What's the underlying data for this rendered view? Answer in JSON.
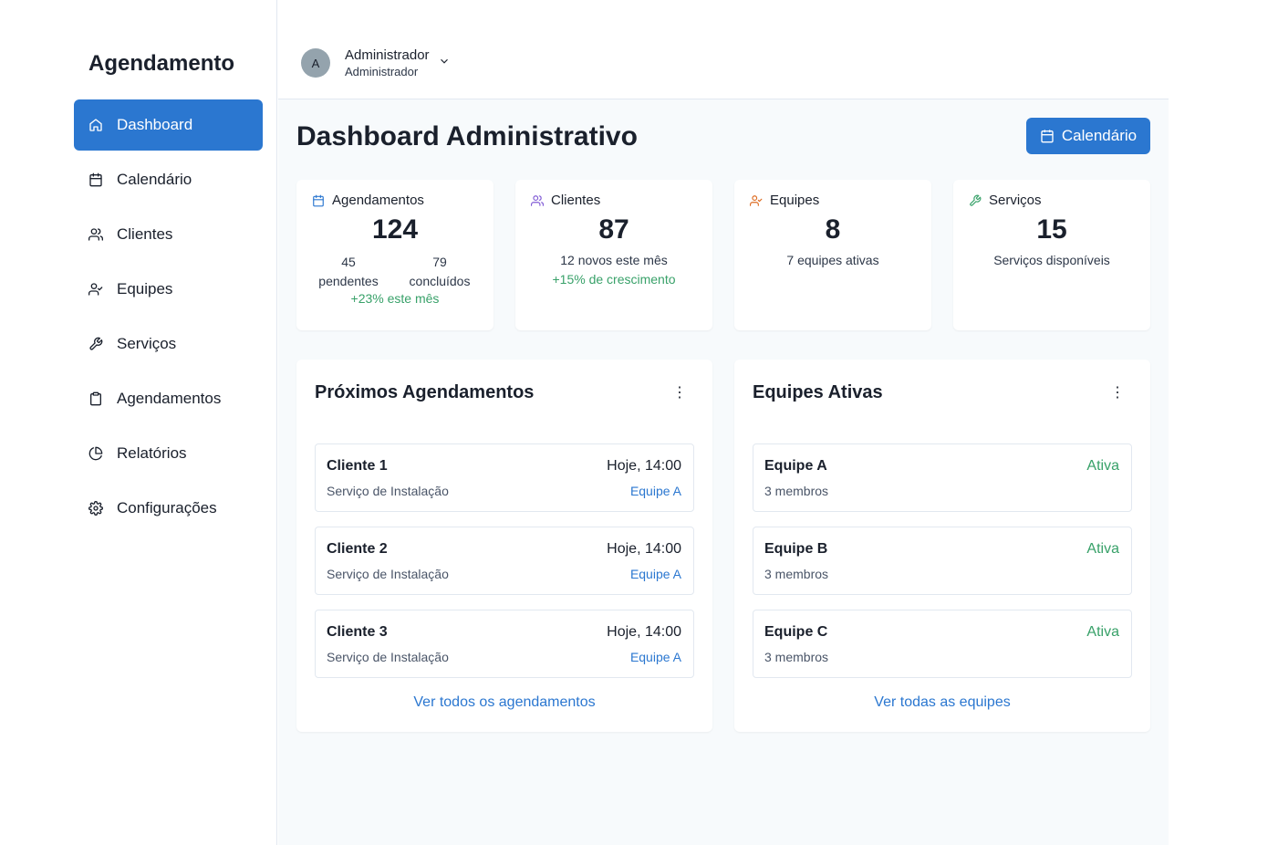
{
  "sidebar": {
    "brand": "Agendamento",
    "items": [
      {
        "label": "Dashboard",
        "icon": "home-icon",
        "active": true
      },
      {
        "label": "Calendário",
        "icon": "calendar-icon",
        "active": false
      },
      {
        "label": "Clientes",
        "icon": "users-icon",
        "active": false
      },
      {
        "label": "Equipes",
        "icon": "user-check-icon",
        "active": false
      },
      {
        "label": "Serviços",
        "icon": "wrench-icon",
        "active": false
      },
      {
        "label": "Agendamentos",
        "icon": "clipboard-icon",
        "active": false
      },
      {
        "label": "Relatórios",
        "icon": "pie-chart-icon",
        "active": false
      },
      {
        "label": "Configurações",
        "icon": "gear-icon",
        "active": false
      }
    ]
  },
  "topbar": {
    "avatar_initial": "A",
    "user_name": "Administrador",
    "user_role": "Administrador"
  },
  "main": {
    "title": "Dashboard Administrativo",
    "calendar_button": "Calendário"
  },
  "stats": {
    "agendamentos": {
      "label": "Agendamentos",
      "value": "124",
      "pending_count": "45",
      "pending_label": "pendentes",
      "done_count": "79",
      "done_label": "concluídos",
      "growth": "+23% este mês"
    },
    "clientes": {
      "label": "Clientes",
      "value": "87",
      "sub": "12 novos este mês",
      "growth": "+15% de crescimento"
    },
    "equipes": {
      "label": "Equipes",
      "value": "8",
      "sub": "7 equipes ativas"
    },
    "servicos": {
      "label": "Serviços",
      "value": "15",
      "sub": "Serviços disponíveis"
    }
  },
  "upcoming": {
    "title": "Próximos Agendamentos",
    "items": [
      {
        "client": "Cliente 1",
        "service": "Serviço de Instalação",
        "time": "Hoje, 14:00",
        "team": "Equipe A"
      },
      {
        "client": "Cliente 2",
        "service": "Serviço de Instalação",
        "time": "Hoje, 14:00",
        "team": "Equipe A"
      },
      {
        "client": "Cliente 3",
        "service": "Serviço de Instalação",
        "time": "Hoje, 14:00",
        "team": "Equipe A"
      }
    ],
    "link": "Ver todos os agendamentos"
  },
  "teams": {
    "title": "Equipes Ativas",
    "items": [
      {
        "name": "Equipe A",
        "members": "3 membros",
        "status": "Ativa"
      },
      {
        "name": "Equipe B",
        "members": "3 membros",
        "status": "Ativa"
      },
      {
        "name": "Equipe C",
        "members": "3 membros",
        "status": "Ativa"
      }
    ],
    "link": "Ver todas as equipes"
  },
  "colors": {
    "accent": "#2b77d0",
    "success": "#38a169",
    "calendar_icon": "#2b77d0",
    "users_icon": "#805ad5",
    "teams_icon": "#dd6b20",
    "services_icon": "#38a169"
  }
}
